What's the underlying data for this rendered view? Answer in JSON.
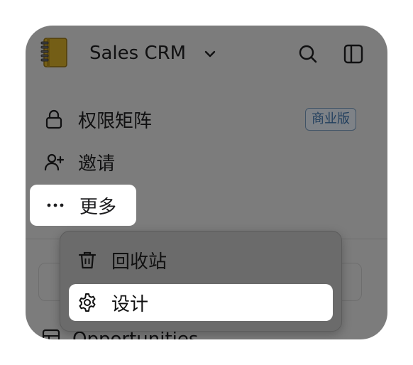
{
  "workspace": {
    "name": "Sales CRM",
    "icon": "notebook-icon"
  },
  "header": {
    "search_icon": "search-icon",
    "sidebar_toggle_icon": "sidebar-toggle-icon"
  },
  "sidebar": {
    "items": [
      {
        "label": "权限矩阵",
        "icon": "lock-icon",
        "badge": "商业版"
      },
      {
        "label": "邀请",
        "icon": "user-plus-icon"
      },
      {
        "label": "更多",
        "icon": "more-horizontal-icon"
      }
    ],
    "background_item": {
      "label": "Opportunities",
      "icon": "table-icon"
    }
  },
  "more_menu": {
    "items": [
      {
        "label": "回收站",
        "icon": "trash-icon"
      },
      {
        "label": "设计",
        "icon": "gear-icon"
      }
    ]
  },
  "colors": {
    "overlay": "rgba(0,0,0,0.42)",
    "badge_text": "#3d6ea3",
    "panel": "#d6d6d6"
  }
}
